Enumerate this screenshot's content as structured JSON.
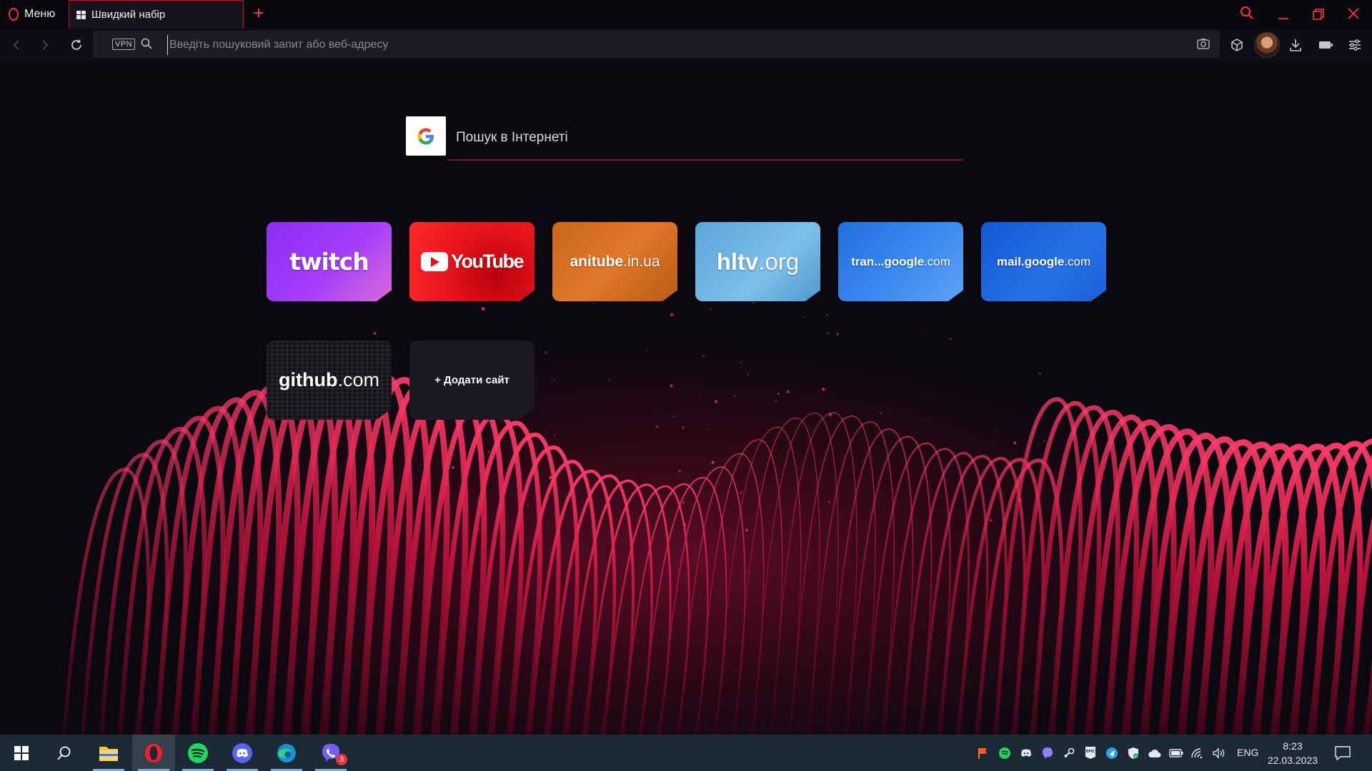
{
  "titlebar": {
    "menu_label": "Меню",
    "active_tab_label": "Швидкий набір",
    "accent": "#ff2a3d"
  },
  "toolbar": {
    "vpn_label": "VPN",
    "address_placeholder": "Введіть пошуковий запит або веб-адресу"
  },
  "search": {
    "placeholder": "Пошук в Інтернеті",
    "engine_icon": "google-icon"
  },
  "speed_dial": {
    "tiles": [
      {
        "id": "twitch",
        "label": "twitch"
      },
      {
        "id": "youtube",
        "label": "YouTube"
      },
      {
        "id": "anitube",
        "label_main": "anitube",
        "label_suffix": ".in.ua"
      },
      {
        "id": "hltv",
        "label_main": "hltv",
        "label_suffix": ".org"
      },
      {
        "id": "translate",
        "label_main": "tran...google",
        "label_suffix": ".com"
      },
      {
        "id": "mail",
        "label_main": "mail.google",
        "label_suffix": ".com"
      },
      {
        "id": "github",
        "label_main": "github",
        "label_suffix": ".com"
      }
    ],
    "add_site_label": "+ Додати сайт"
  },
  "taskbar": {
    "apps": [
      "windows-start",
      "search",
      "file-explorer",
      "opera",
      "spotify",
      "discord",
      "edge",
      "viber"
    ],
    "viber_badge": "3",
    "language": "ENG",
    "time": "8:23",
    "date": "22.03.2023"
  }
}
